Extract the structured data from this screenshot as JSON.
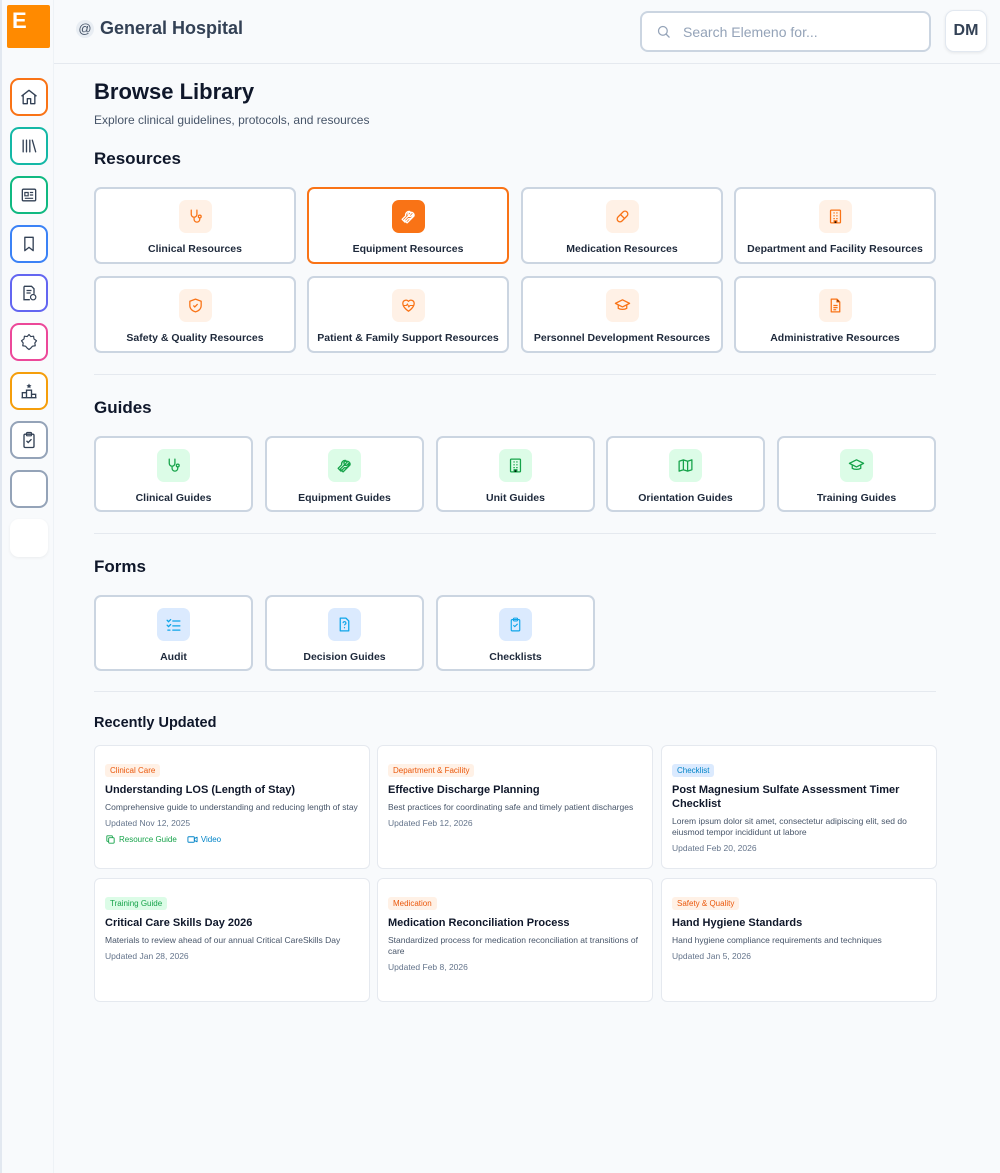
{
  "logo_letter": "E",
  "header": {
    "org_symbol": "@",
    "org_name": "General Hospital",
    "search_placeholder": "Search Elemeno for...",
    "avatar_initials": "DM"
  },
  "sidebar": {
    "items": [
      {
        "name": "home",
        "icon": "home-icon",
        "color": "#f97316"
      },
      {
        "name": "library",
        "icon": "library-icon",
        "color": "#14b8a6"
      },
      {
        "name": "news",
        "icon": "newspaper-icon",
        "color": "#10b981"
      },
      {
        "name": "bookmarks",
        "icon": "bookmark-icon",
        "color": "#3b82f6"
      },
      {
        "name": "documents",
        "icon": "document-check-icon",
        "color": "#6366f1"
      },
      {
        "name": "badges",
        "icon": "badge-icon",
        "color": "#ec4899"
      },
      {
        "name": "leaderboard",
        "icon": "podium-icon",
        "color": "#f59e0b"
      },
      {
        "name": "checklists",
        "icon": "clipboard-check-icon",
        "color": "#94a3b8"
      },
      {
        "name": "blank-1",
        "icon": "",
        "color": "#94a3b8"
      },
      {
        "name": "blank-2",
        "icon": "",
        "color": "#ffffff"
      }
    ]
  },
  "page": {
    "title": "Browse Library",
    "subtitle": "Explore clinical guidelines, protocols, and resources"
  },
  "resources": {
    "title": "Resources",
    "items": [
      {
        "label": "Clinical Resources",
        "icon": "stethoscope-icon"
      },
      {
        "label": "Equipment Resources",
        "icon": "wrench-icon",
        "selected": true
      },
      {
        "label": "Medication Resources",
        "icon": "pill-icon"
      },
      {
        "label": "Department and Facility Resources",
        "icon": "building-icon"
      },
      {
        "label": "Safety & Quality Resources",
        "icon": "shield-check-icon"
      },
      {
        "label": "Patient & Family Support Resources",
        "icon": "heart-pulse-icon"
      },
      {
        "label": "Personnel Development Resources",
        "icon": "graduation-cap-icon"
      },
      {
        "label": "Administrative Resources",
        "icon": "file-text-icon"
      }
    ]
  },
  "guides": {
    "title": "Guides",
    "items": [
      {
        "label": "Clinical Guides",
        "icon": "stethoscope-icon"
      },
      {
        "label": "Equipment Guides",
        "icon": "wrench-icon"
      },
      {
        "label": "Unit Guides",
        "icon": "building-icon"
      },
      {
        "label": "Orientation Guides",
        "icon": "map-icon"
      },
      {
        "label": "Training Guides",
        "icon": "graduation-cap-icon"
      }
    ]
  },
  "forms": {
    "title": "Forms",
    "items": [
      {
        "label": "Audit",
        "icon": "list-check-icon"
      },
      {
        "label": "Decision Guides",
        "icon": "file-question-icon"
      },
      {
        "label": "Checklists",
        "icon": "clipboard-check-icon"
      }
    ]
  },
  "recent": {
    "title": "Recently Updated",
    "cards": [
      {
        "badge": "Clinical Care",
        "badge_color": "orange",
        "title": "Understanding LOS (Length of Stay)",
        "desc": "Comprehensive guide to understanding and reducing length of stay",
        "date": "Updated Nov 12, 2025",
        "link1": "Resource Guide",
        "link2": "Video"
      },
      {
        "badge": "Department & Facility",
        "badge_color": "orange",
        "title": "Effective Discharge Planning",
        "desc": "Best practices for coordinating safe and timely patient discharges",
        "date": "Updated Feb 12, 2026"
      },
      {
        "badge": "Checklist",
        "badge_color": "blue",
        "title": "Post Magnesium Sulfate Assessment Timer Checklist",
        "desc": "Lorem ipsum dolor sit amet, consectetur adipiscing elit, sed do eiusmod tempor incididunt ut labore",
        "date": "Updated Feb 20, 2026"
      },
      {
        "badge": "Training Guide",
        "badge_color": "green",
        "title": "Critical Care Skills Day 2026",
        "desc": "Materials to review ahead of our annual Critical CareSkills Day",
        "date": "Updated Jan 28, 2026"
      },
      {
        "badge": "Medication",
        "badge_color": "orange",
        "title": "Medication Reconciliation Process",
        "desc": "Standardized process for medication reconciliation at transitions of care",
        "date": "Updated Feb 8, 2026"
      },
      {
        "badge": "Safety & Quality",
        "badge_color": "orange",
        "title": "Hand Hygiene Standards",
        "desc": "Hand hygiene compliance requirements and techniques",
        "date": "Updated Jan 5, 2026"
      }
    ]
  }
}
